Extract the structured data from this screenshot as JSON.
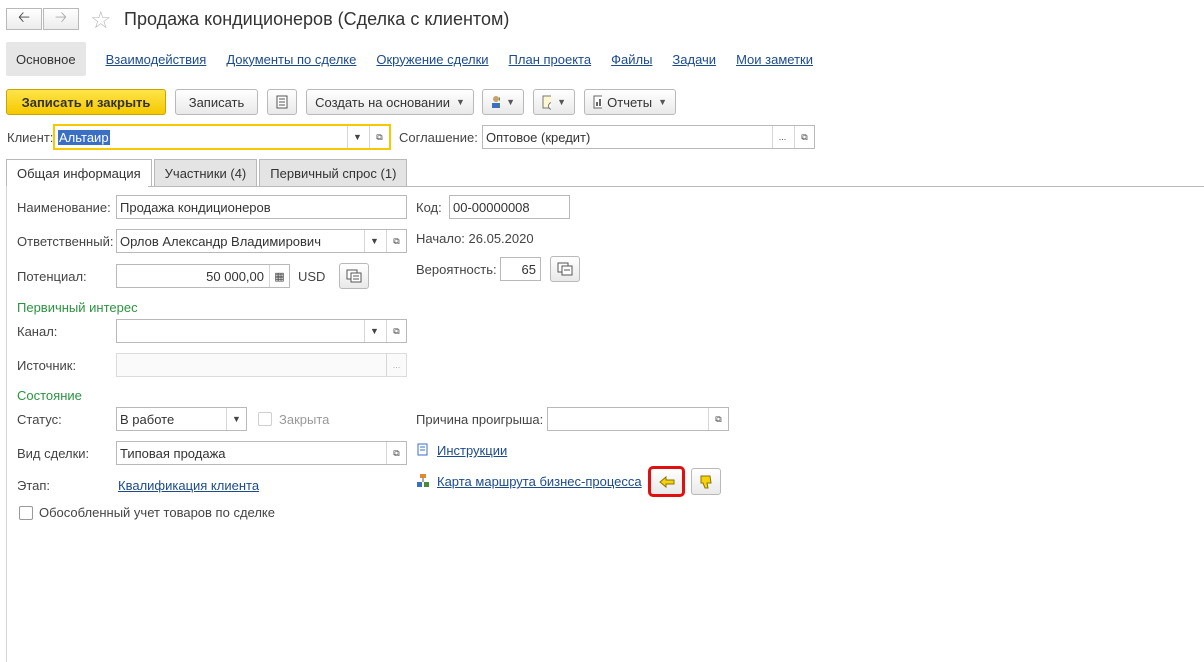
{
  "header": {
    "title": "Продажа кондиционеров (Сделка с клиентом)",
    "back_icon": "arrow-left-icon",
    "forward_icon": "arrow-right-icon",
    "favorite_icon": "star-icon"
  },
  "topnav": {
    "active": "Основное",
    "links": [
      "Взаимодействия",
      "Документы по сделке",
      "Окружение сделки",
      "План проекта",
      "Файлы",
      "Задачи",
      "Мои заметки"
    ]
  },
  "toolbar": {
    "save_close": "Записать и закрыть",
    "save": "Записать",
    "create_based": "Создать на основании",
    "reports": "Отчеты"
  },
  "client": {
    "label": "Клиент:",
    "value": "Альтаир",
    "agreement_label": "Соглашение:",
    "agreement_value": "Оптовое (кредит)"
  },
  "tabs": [
    "Общая информация",
    "Участники (4)",
    "Первичный спрос (1)"
  ],
  "general": {
    "name_label": "Наименование:",
    "name_value": "Продажа кондиционеров",
    "code_label": "Код:",
    "code_value": "00-00000008",
    "responsible_label": "Ответственный:",
    "responsible_value": "Орлов Александр Владимирович",
    "start_text": "Начало: 26.05.2020",
    "potential_label": "Потенциал:",
    "potential_value": "50 000,00",
    "currency": "USD",
    "probability_label": "Вероятность:",
    "probability_value": "65",
    "primary_interest": "Первичный интерес",
    "channel_label": "Канал:",
    "source_label": "Источник:",
    "state_section": "Состояние",
    "status_label": "Статус:",
    "status_value": "В работе",
    "closed_label": "Закрыта",
    "loss_reason_label": "Причина проигрыша:",
    "deal_type_label": "Вид сделки:",
    "deal_type_value": "Типовая продажа",
    "instructions_link": "Инструкции",
    "stage_label": "Этап:",
    "stage_link": "Квалификация клиента",
    "route_map_link": "Карта маршрута бизнес-процесса",
    "separate_accounting_label": "Обособленный учет товаров по сделке"
  },
  "colors": {
    "accent_yellow": "#f5c800",
    "link_blue": "#1c4b8c",
    "section_green": "#2b9440",
    "highlight_red": "#e01010"
  }
}
